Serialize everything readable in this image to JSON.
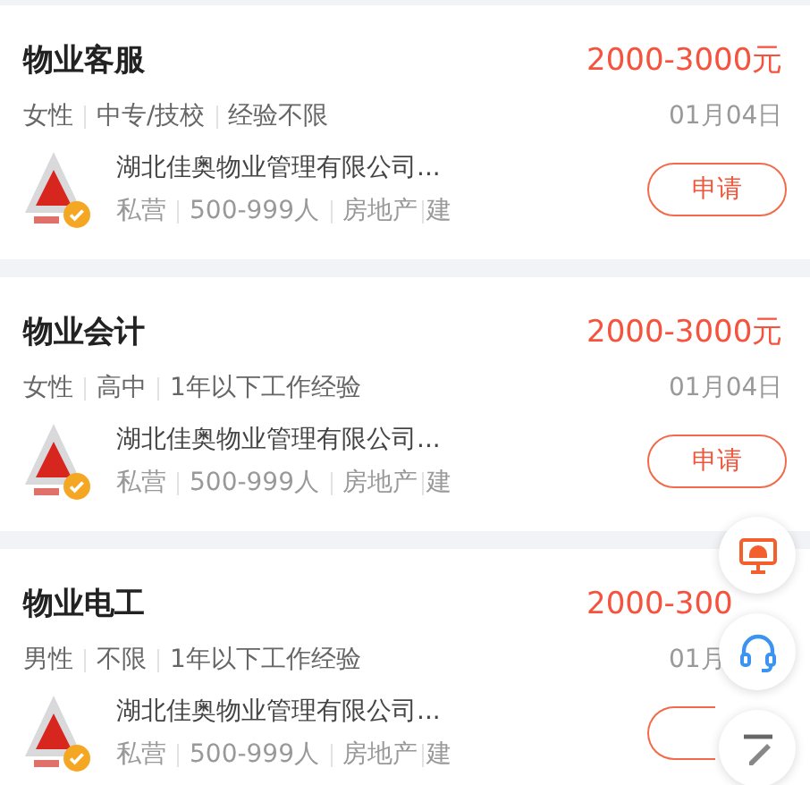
{
  "jobs": [
    {
      "title": "物业客服",
      "salary": "2000-3000元",
      "tags": [
        "女性",
        "中专/技校",
        "经验不限"
      ],
      "date": "01月04日",
      "company": "湖北佳奥物业管理有限公司...",
      "company_tags": [
        "私营",
        "500-999人",
        "房地产",
        "建"
      ],
      "verified": true,
      "apply": "申请"
    },
    {
      "title": "物业会计",
      "salary": "2000-3000元",
      "tags": [
        "女性",
        "高中",
        "1年以下工作经验"
      ],
      "date": "01月04日",
      "company": "湖北佳奥物业管理有限公司...",
      "company_tags": [
        "私营",
        "500-999人",
        "房地产",
        "建"
      ],
      "verified": true,
      "apply": "申请"
    },
    {
      "title": "物业电工",
      "salary": "2000-300",
      "tags": [
        "男性",
        "不限",
        "1年以下工作经验"
      ],
      "date": "01月",
      "company": "湖北佳奥物业管理有限公司...",
      "company_tags": [
        "私营",
        "500-999人",
        "房地产",
        "建"
      ],
      "verified": true
    }
  ],
  "floating_buttons": [
    {
      "kind": "monitor"
    },
    {
      "kind": "headset"
    },
    {
      "kind": "edit"
    }
  ]
}
